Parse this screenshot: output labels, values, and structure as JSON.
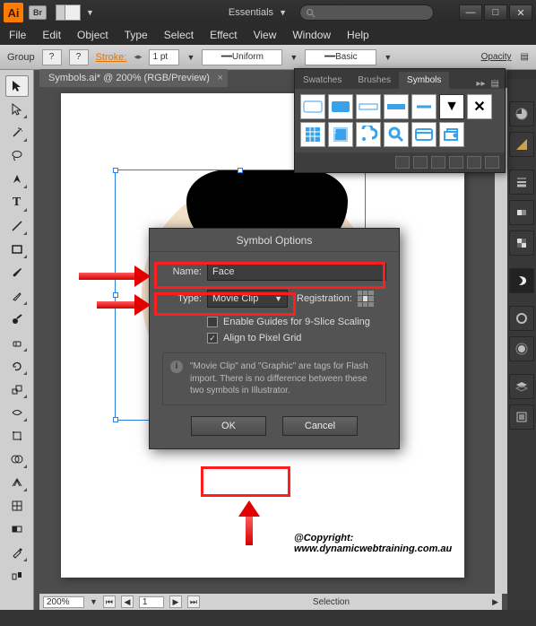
{
  "titlebar": {
    "app_abbrev": "Ai",
    "bridge_abbrev": "Br",
    "workspace": "Essentials"
  },
  "menu": {
    "file": "File",
    "edit": "Edit",
    "object": "Object",
    "type": "Type",
    "select": "Select",
    "effect": "Effect",
    "view": "View",
    "window": "Window",
    "help": "Help"
  },
  "options": {
    "group_label": "Group",
    "stroke_label": "Stroke:",
    "stroke_value": "1 pt",
    "uniform": "Uniform",
    "basic": "Basic",
    "opacity": "Opacity"
  },
  "document": {
    "tab": "Symbols.ai* @ 200% (RGB/Preview)"
  },
  "symbols_panel": {
    "tabs": {
      "swatches": "Swatches",
      "brushes": "Brushes",
      "symbols": "Symbols"
    }
  },
  "dialog": {
    "title": "Symbol Options",
    "name_label": "Name:",
    "name_value": "Face",
    "type_label": "Type:",
    "type_value": "Movie Clip",
    "registration_label": "Registration:",
    "enable_guides": "Enable Guides for 9-Slice Scaling",
    "align_pixel": "Align to Pixel Grid",
    "info": "\"Movie Clip\" and \"Graphic\" are tags for Flash import. There is no difference between these two symbols in Illustrator.",
    "ok": "OK",
    "cancel": "Cancel"
  },
  "status": {
    "zoom": "200%",
    "artboard": "1",
    "mode": "Selection"
  },
  "copyright": "@Copyright: www.dynamicwebtraining.com.au"
}
